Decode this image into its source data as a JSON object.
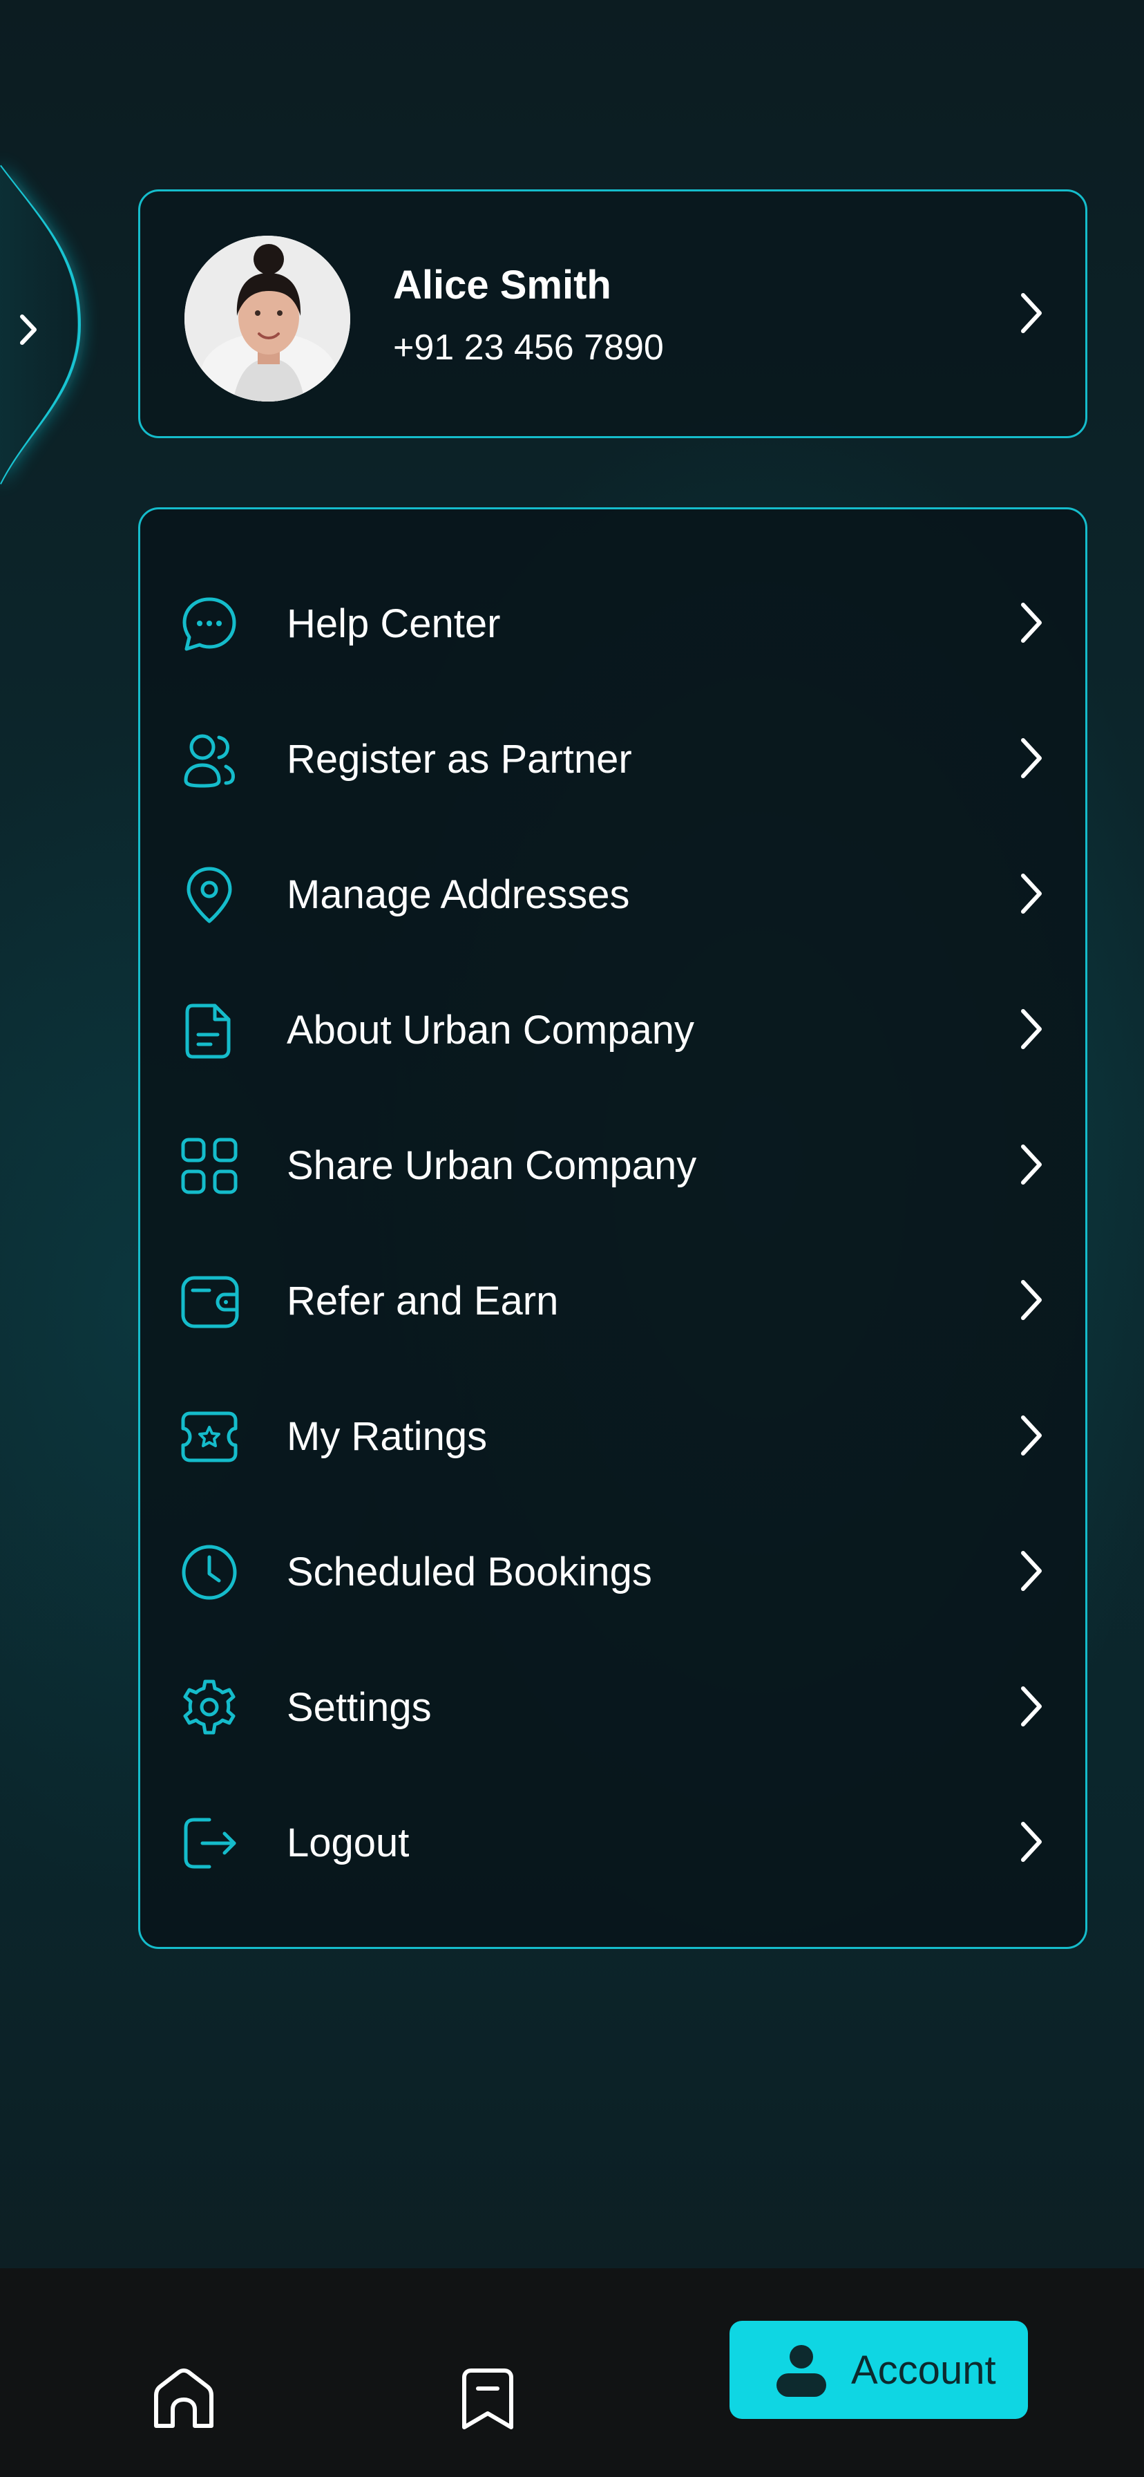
{
  "profile": {
    "name": "Alice Smith",
    "phone": "+91 23 456 7890"
  },
  "menu": {
    "items": [
      {
        "label": "Help Center",
        "icon": "chat-bubble-icon"
      },
      {
        "label": "Register as Partner",
        "icon": "users-icon"
      },
      {
        "label": "Manage Addresses",
        "icon": "location-pin-icon"
      },
      {
        "label": "About Urban Company",
        "icon": "document-icon"
      },
      {
        "label": "Share Urban Company",
        "icon": "grid-icon"
      },
      {
        "label": "Refer and Earn",
        "icon": "wallet-icon"
      },
      {
        "label": "My Ratings",
        "icon": "ticket-star-icon"
      },
      {
        "label": "Scheduled Bookings",
        "icon": "clock-icon"
      },
      {
        "label": "Settings",
        "icon": "gear-icon"
      },
      {
        "label": "Logout",
        "icon": "logout-icon"
      }
    ]
  },
  "bottom_nav": {
    "account_label": "Account",
    "items": [
      "home-icon",
      "bookmark-icon",
      "account-icon"
    ]
  },
  "colors": {
    "accent": "#15bccb",
    "active_tab": "#0fd6e3",
    "text": "#ffffff",
    "nav_bg": "#111314"
  }
}
